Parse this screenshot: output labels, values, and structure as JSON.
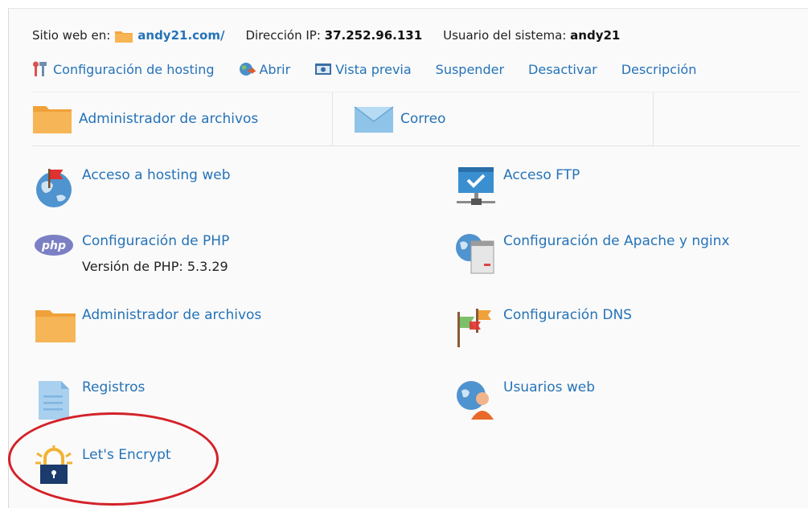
{
  "header": {
    "site_label": "Sitio web en:",
    "site_value": "andy21.com/",
    "ip_label": "Dirección IP:",
    "ip_value": "37.252.96.131",
    "user_label": "Usuario del sistema:",
    "user_value": "andy21"
  },
  "actions": [
    {
      "label": "Configuración de hosting",
      "icon": "tools-icon"
    },
    {
      "label": "Abrir",
      "icon": "globe-arrow-icon"
    },
    {
      "label": "Vista previa",
      "icon": "preview-icon"
    },
    {
      "label": "Suspender",
      "icon": ""
    },
    {
      "label": "Desactivar",
      "icon": ""
    },
    {
      "label": "Descripción",
      "icon": ""
    }
  ],
  "tiles": [
    {
      "label": "Administrador de archivos",
      "icon": "folder-icon"
    },
    {
      "label": "Correo",
      "icon": "mail-icon"
    }
  ],
  "tools": {
    "hosting_access": {
      "label": "Acceso a hosting web",
      "icon": "globe-flag-icon"
    },
    "ftp_access": {
      "label": "Acceso FTP",
      "icon": "ftp-icon"
    },
    "php_config": {
      "label": "Configuración de PHP",
      "icon": "php-icon",
      "sub": "Versión de PHP: 5.3.29"
    },
    "apache_config": {
      "label": "Configuración de Apache y nginx",
      "icon": "server-globe-icon"
    },
    "file_manager": {
      "label": "Administrador de archivos",
      "icon": "folder-icon"
    },
    "dns_config": {
      "label": "Configuración DNS",
      "icon": "dns-flags-icon"
    },
    "logs": {
      "label": "Registros",
      "icon": "document-icon"
    },
    "web_users": {
      "label": "Usuarios web",
      "icon": "globe-user-icon"
    },
    "lets_encrypt": {
      "label": "Let's Encrypt",
      "icon": "padlock-icon"
    }
  },
  "highlight_color": "#d42128",
  "link_color": "#2573b8"
}
